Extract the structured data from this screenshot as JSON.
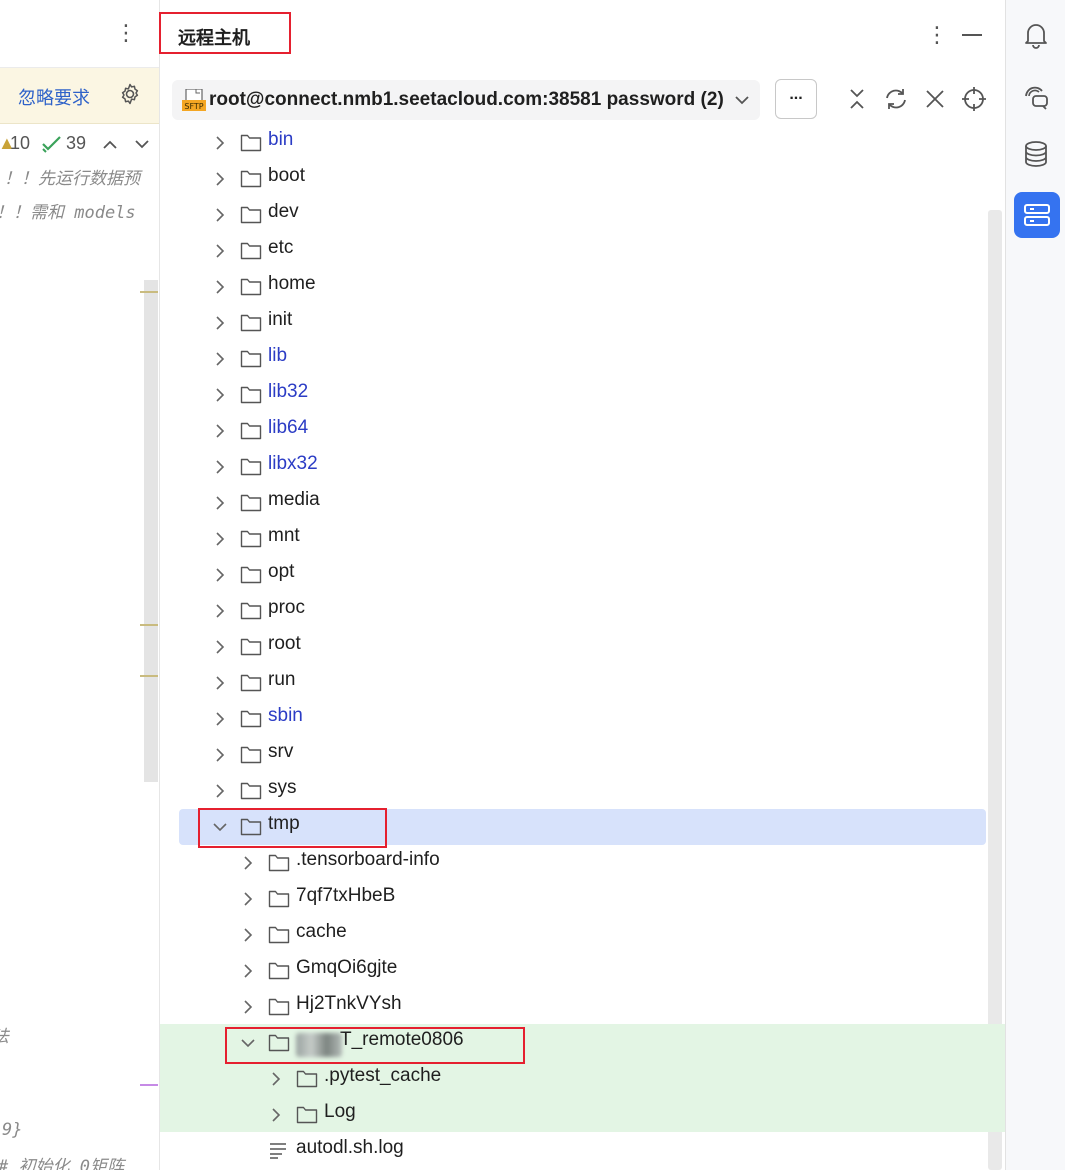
{
  "left_editor": {
    "ignore_link": "忽略要求",
    "warning_count": "10",
    "check_count": "39",
    "code_lines": [
      "！！先运行数据预",
      "！！需和 models",
      "法",
      "9}",
      "# 初始化 0矩阵"
    ]
  },
  "panel": {
    "title": "远程主机",
    "connection": "root@connect.nmb1.seetacloud.com:38581 password (2)",
    "more_label": "...",
    "sftp_badge": "SFTP"
  },
  "tree": [
    {
      "label": "bin",
      "link": true,
      "expanded": false
    },
    {
      "label": "boot",
      "link": false,
      "expanded": false
    },
    {
      "label": "dev",
      "link": false,
      "expanded": false
    },
    {
      "label": "etc",
      "link": false,
      "expanded": false
    },
    {
      "label": "home",
      "link": false,
      "expanded": false
    },
    {
      "label": "init",
      "link": false,
      "expanded": false
    },
    {
      "label": "lib",
      "link": true,
      "expanded": false
    },
    {
      "label": "lib32",
      "link": true,
      "expanded": false
    },
    {
      "label": "lib64",
      "link": true,
      "expanded": false
    },
    {
      "label": "libx32",
      "link": true,
      "expanded": false
    },
    {
      "label": "media",
      "link": false,
      "expanded": false
    },
    {
      "label": "mnt",
      "link": false,
      "expanded": false
    },
    {
      "label": "opt",
      "link": false,
      "expanded": false
    },
    {
      "label": "proc",
      "link": false,
      "expanded": false
    },
    {
      "label": "root",
      "link": false,
      "expanded": false
    },
    {
      "label": "run",
      "link": false,
      "expanded": false
    },
    {
      "label": "sbin",
      "link": true,
      "expanded": false
    },
    {
      "label": "srv",
      "link": false,
      "expanded": false
    },
    {
      "label": "sys",
      "link": false,
      "expanded": false
    },
    {
      "label": "tmp",
      "link": false,
      "expanded": true
    },
    {
      "label": ".tensorboard-info",
      "link": false,
      "expanded": false
    },
    {
      "label": "7qf7txHbeB",
      "link": false,
      "expanded": false
    },
    {
      "label": "cache",
      "link": false,
      "expanded": false
    },
    {
      "label": "GmqOi6gjte",
      "link": false,
      "expanded": false
    },
    {
      "label": "Hj2TnkVYsh",
      "link": false,
      "expanded": false
    },
    {
      "label": "T_remote0806",
      "link": false,
      "expanded": true
    },
    {
      "label": ".pytest_cache",
      "link": false,
      "expanded": false
    },
    {
      "label": "Log",
      "link": false,
      "expanded": false
    },
    {
      "label": "autodl.sh.log",
      "link": false,
      "expanded": false
    }
  ],
  "colors": {
    "accent": "#3573f0",
    "selection": "#d7e2fb",
    "changed": "#e3f5e4",
    "highlight_box": "#e5202f",
    "link_text": "#2b3cc5"
  }
}
